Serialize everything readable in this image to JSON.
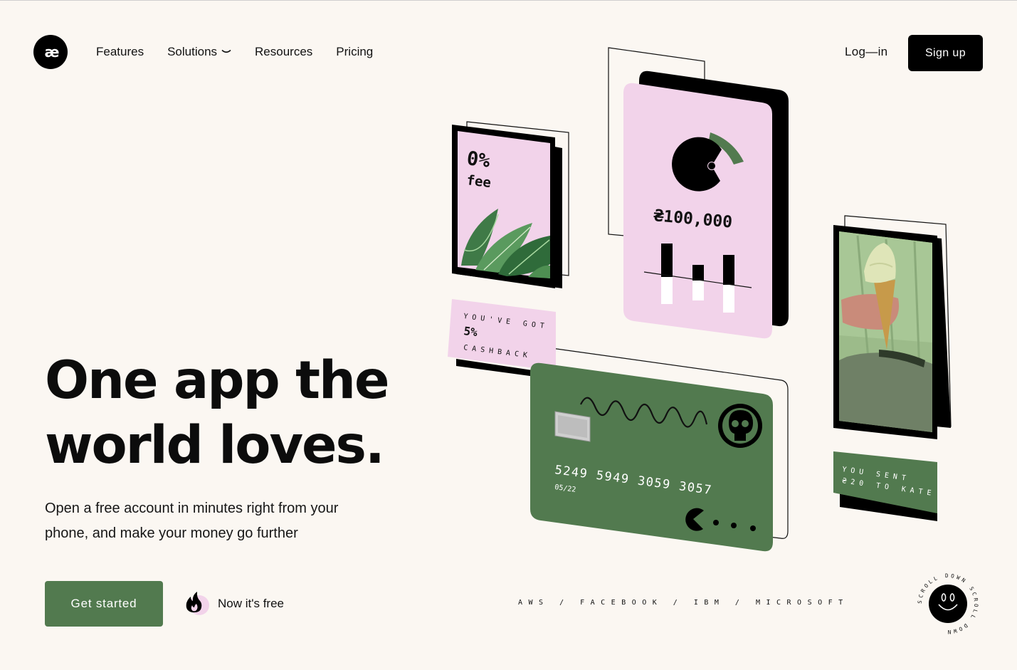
{
  "nav": {
    "logo_text": "æ",
    "items": [
      {
        "label": "Features"
      },
      {
        "label": "Solutions",
        "has_dropdown": true
      },
      {
        "label": "Resources"
      },
      {
        "label": "Pricing"
      }
    ],
    "login_label": "Log—in",
    "signup_label": "Sign up"
  },
  "hero": {
    "headline_line1": "One app the",
    "headline_line2": "world loves.",
    "subtitle": "Open a free account in minutes right from your phone, and make your money go further",
    "cta_label": "Get started",
    "free_label": "Now it's free"
  },
  "partners": "AWS / FACEBOOK / IBM / MICROSOFT",
  "cards": {
    "fee_line1": "0%",
    "fee_line2": "fee",
    "balance": "₴100,000",
    "cashback_line1": "YOU'VE GOT",
    "cashback_line2": "5%",
    "cashback_line3": "CASHBACK",
    "card_number": "5249 5949 3059 3057",
    "card_expiry": "05/22",
    "sent_line1": "YOU SENT",
    "sent_line2": "₴20 TO KATE"
  },
  "scroll_badge_text": "SCROLL DOWN SCROLL DOWN",
  "colors": {
    "background": "#fbf7f2",
    "accent_green": "#527a4f",
    "pink": "#f2d3ea",
    "black": "#000000"
  },
  "icons": [
    "logo-icon",
    "chevron-down-icon",
    "flame-icon",
    "smiley-icon",
    "skull-icon",
    "pacman-icon",
    "chip-icon"
  ]
}
